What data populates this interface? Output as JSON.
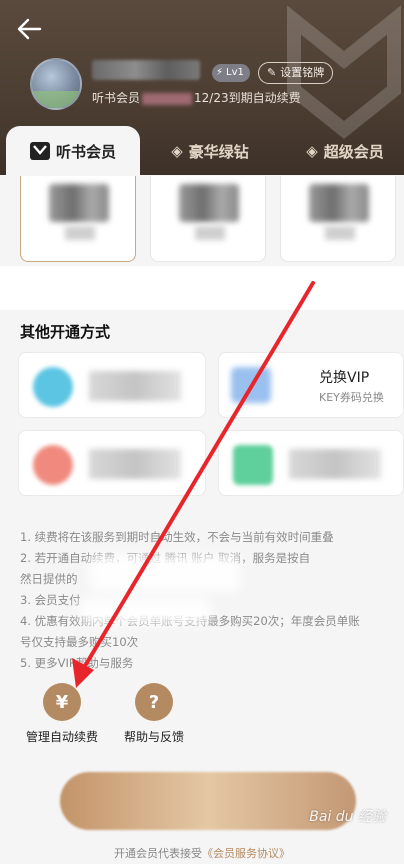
{
  "header": {
    "status_prefix": "听书会员",
    "status_suffix": "12/23到期自动续费",
    "level_label": "Lv1",
    "badge_button_label": "设置铭牌"
  },
  "tabs": [
    {
      "label": "听书会员"
    },
    {
      "label": "豪华绿钻"
    },
    {
      "label": "超级会员"
    }
  ],
  "other": {
    "title": "其他开通方式",
    "options": [
      {
        "main": "",
        "sub": ""
      },
      {
        "main": "兑换VIP",
        "sub": "KEY券码兑换"
      },
      {
        "main": "",
        "sub": ""
      },
      {
        "main": "",
        "sub": ""
      }
    ]
  },
  "notes": [
    "1. 续费将在该服务到期时自动生效，不会与当前有效时间重叠",
    "2. 若开通自动续费，可通过 腾讯 账户 取消，服务是按自",
    "然日提供的",
    "3. 会员支付",
    "4. 优惠有效期内单个会员单账号支持最多购买20次；年度会员单账",
    "号仅支持最多购买10次",
    "5. 更多VIP帮助与服务"
  ],
  "actions": [
    {
      "icon": "¥",
      "label": "管理自动续费"
    },
    {
      "icon": "?",
      "label": "帮助与反馈"
    }
  ],
  "agreement": {
    "prefix": "开通会员代表接受",
    "link": "《会员服务协议》"
  },
  "watermark_text": "Bai du 经验",
  "colors": {
    "accent": "#b48a62",
    "header_bg": "#4b3d31",
    "arrow": "#e8252b"
  }
}
